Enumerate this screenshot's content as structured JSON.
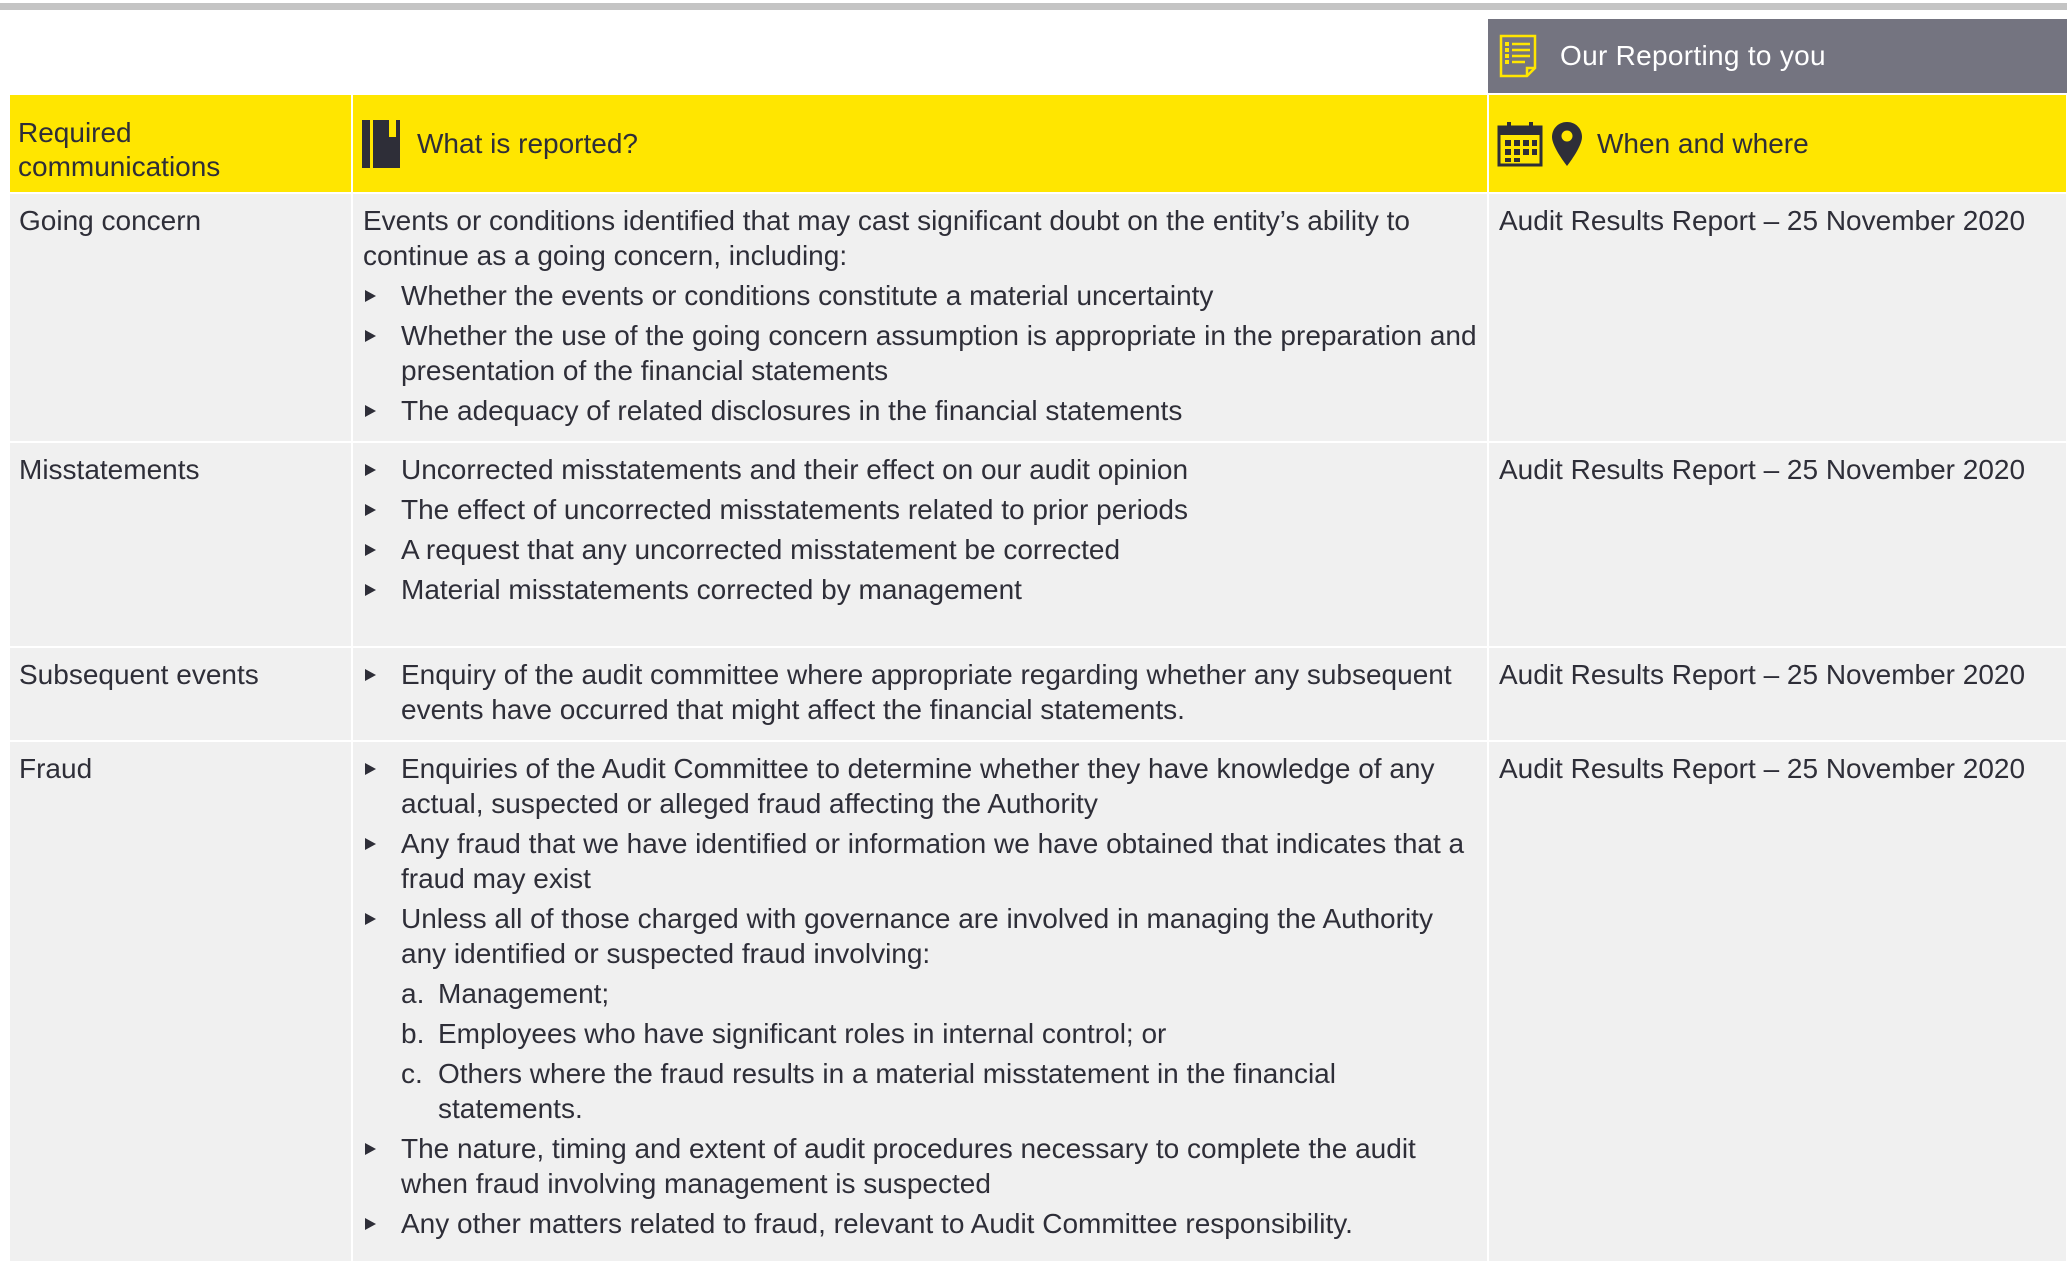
{
  "banner": {
    "title": "Our Reporting to you",
    "icon": "report-document-icon"
  },
  "columns": {
    "col1": "Required communications",
    "col2": "What is reported?",
    "col2_icon": "notebook-icon",
    "col3": "When and where",
    "col3_icons": [
      "calendar-icon",
      "map-pin-icon"
    ]
  },
  "rows": [
    {
      "topic": "Going concern",
      "intro": "Events or conditions identified that may cast significant doubt on the entity’s ability to continue as a going concern, including:",
      "bullets": [
        "Whether the events or conditions constitute a material uncertainty",
        "Whether the use of the going concern assumption is appropriate in the preparation and presentation of the financial statements",
        "The adequacy of related disclosures in the financial statements"
      ],
      "when": "Audit Results Report – 25 November 2020"
    },
    {
      "topic": "Misstatements",
      "bullets": [
        "Uncorrected misstatements and their effect on our audit opinion",
        "The effect of uncorrected misstatements related to prior periods",
        "A request that any uncorrected misstatement be corrected",
        "Material misstatements corrected by management"
      ],
      "when": "Audit Results Report – 25 November 2020"
    },
    {
      "topic": "Subsequent events",
      "bullets": [
        "Enquiry of the audit committee where appropriate regarding whether any subsequent events have occurred that might affect the financial statements."
      ],
      "when": "Audit Results Report – 25 November 2020"
    },
    {
      "topic": "Fraud",
      "bullets": [
        "Enquiries of the Audit Committee to determine whether they have knowledge of any actual, suspected or alleged fraud affecting the Authority",
        "Any fraud that we have identified or information we have obtained that indicates that a fraud may exist",
        "Unless all of those charged with governance are involved in managing the Authority any identified or suspected fraud involving:",
        "The nature, timing and extent of audit procedures necessary to complete the audit when fraud involving management is suspected",
        "Any other matters related to fraud, relevant to Audit Committee responsibility."
      ],
      "sub_items": [
        {
          "marker": "a.",
          "text": "Management;"
        },
        {
          "marker": "b.",
          "text": "Employees who have significant roles in internal control; or"
        },
        {
          "marker": "c.",
          "text": "Others where the fraud results in a material misstatement in the financial statements."
        }
      ],
      "when": "Audit Results Report – 25 November 2020"
    }
  ],
  "colors": {
    "accent_yellow": "#ffe600",
    "banner_grey": "#747480",
    "row_grey": "#f0f0f0",
    "text": "#2e2e38"
  }
}
